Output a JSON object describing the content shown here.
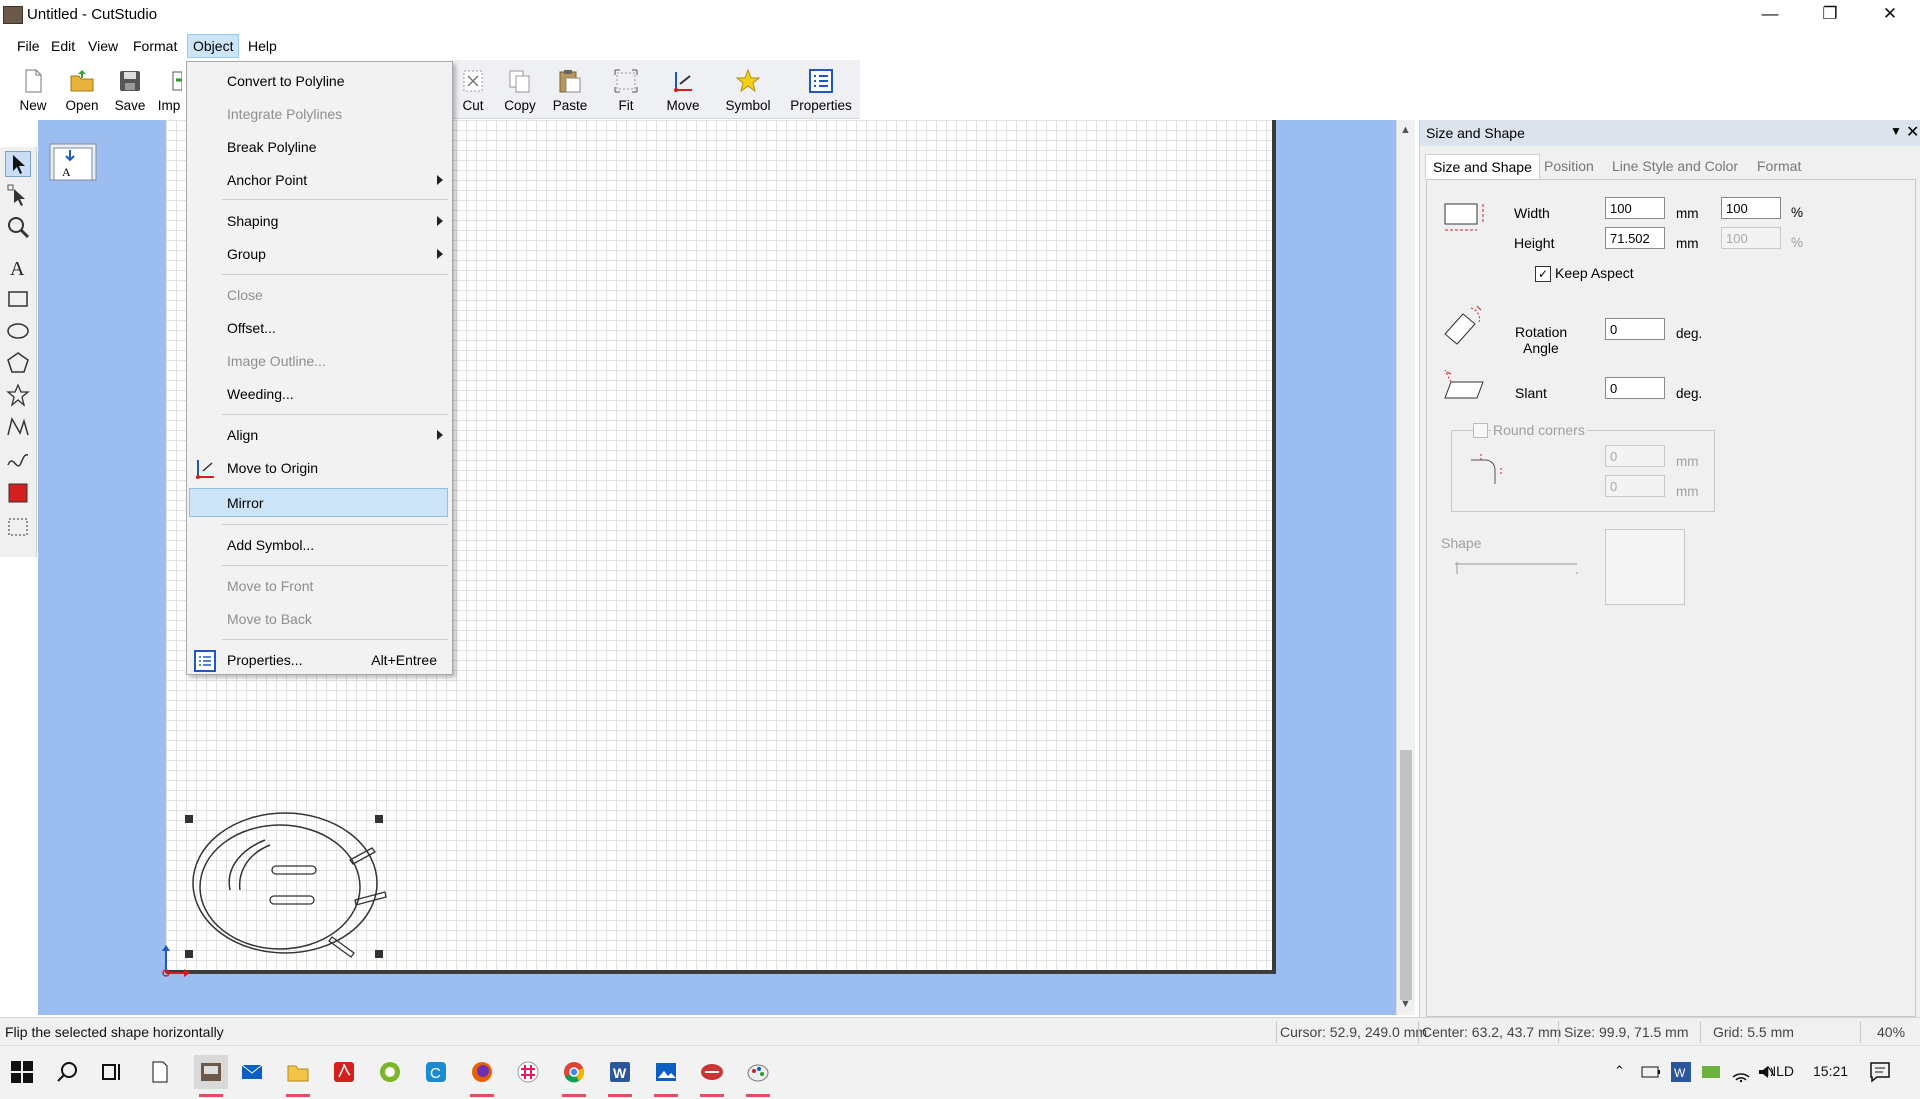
{
  "window": {
    "title": "Untitled - CutStudio"
  },
  "menubar": {
    "items": [
      "File",
      "Edit",
      "View",
      "Format",
      "Object",
      "Help"
    ]
  },
  "toolbar": {
    "new": "New",
    "open": "Open",
    "save": "Save",
    "import": "Imp",
    "cut": "Cut",
    "copy": "Copy",
    "paste": "Paste",
    "fit": "Fit",
    "move": "Move",
    "symbol": "Symbol",
    "properties": "Properties"
  },
  "object_menu": {
    "convert_to_polyline": "Convert to Polyline",
    "integrate_polylines": "Integrate Polylines",
    "break_polyline": "Break Polyline",
    "anchor_point": "Anchor Point",
    "shaping": "Shaping",
    "group": "Group",
    "close": "Close",
    "offset": "Offset...",
    "image_outline": "Image Outline...",
    "weeding": "Weeding...",
    "align": "Align",
    "move_to_origin": "Move to Origin",
    "mirror": "Mirror",
    "add_symbol": "Add Symbol...",
    "move_to_front": "Move to Front",
    "move_to_back": "Move to Back",
    "properties": "Properties...",
    "properties_shortcut": "Alt+Entree"
  },
  "panel": {
    "title": "Size and Shape",
    "tabs": [
      "Size and Shape",
      "Position",
      "Line Style and Color",
      "Format"
    ],
    "width_label": "Width",
    "width_value": "100",
    "width_pct": "100",
    "height_label": "Height",
    "height_value": "71.502",
    "height_pct": "100",
    "unit_mm": "mm",
    "unit_pct": "%",
    "keep_aspect": "Keep Aspect",
    "rotation_label_1": "Rotation",
    "rotation_label_2": "Angle",
    "rotation_value": "0",
    "unit_deg": "deg.",
    "slant_label": "Slant",
    "slant_value": "0",
    "round_corners": "Round corners",
    "round_value_1": "0",
    "round_value_2": "0",
    "shape_label": "Shape"
  },
  "statusbar": {
    "hint": "Flip the selected shape horizontally",
    "cursor": "Cursor: 52.9, 249.0 mm",
    "center": "Center: 63.2, 43.7 mm",
    "size": "Size: 99.9, 71.5 mm",
    "grid": "Grid: 5.5 mm",
    "zoom": "40%"
  },
  "taskbar": {
    "language": "NLD",
    "time": "15:21"
  },
  "colors": {
    "accent_blue": "#0a5fc4",
    "canvas_bg": "#9cbdf0",
    "menu_highlight": "#cce4f7",
    "red": "#d41f1f"
  }
}
